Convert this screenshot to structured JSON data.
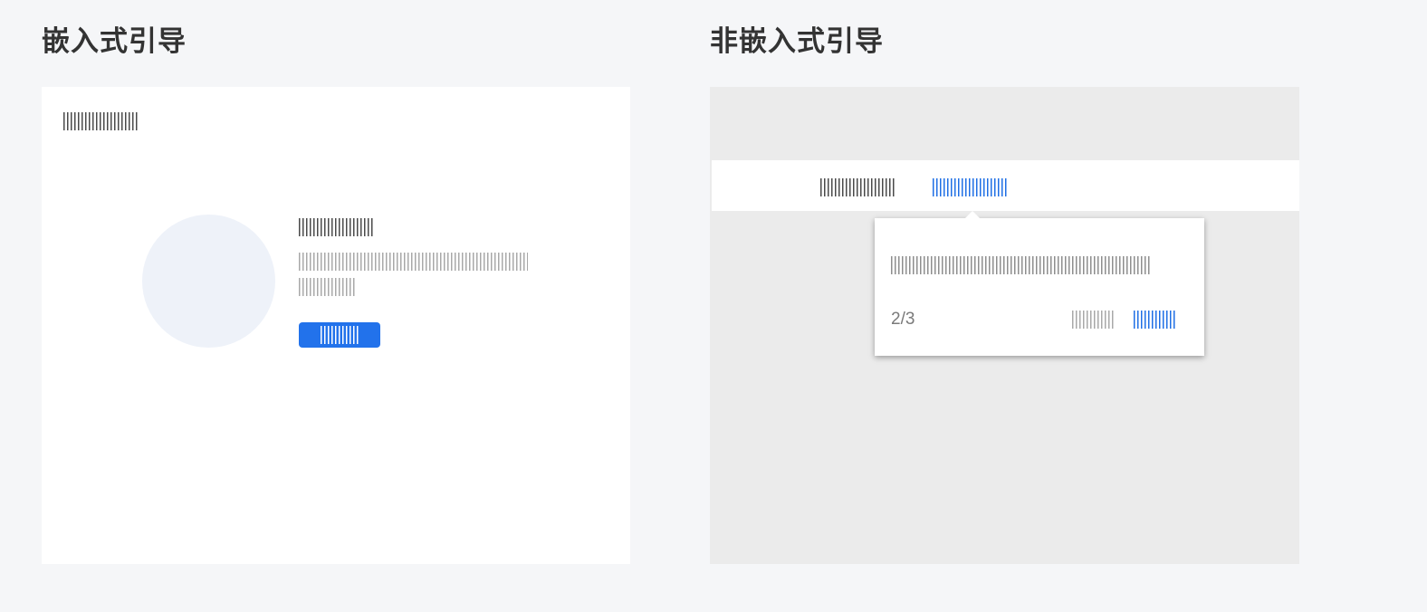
{
  "embedded_section": {
    "title": "嵌入式引导"
  },
  "non_embedded_section": {
    "title": "非嵌入式引导",
    "popover": {
      "step_counter": "2/3"
    }
  },
  "colors": {
    "page_background": "#f5f6f8",
    "panel_background": "#ffffff",
    "overlay_background": "#ebebeb",
    "accent_blue": "#2272eb",
    "illustration_fill": "#eef2f9",
    "heading_text": "#333333"
  }
}
